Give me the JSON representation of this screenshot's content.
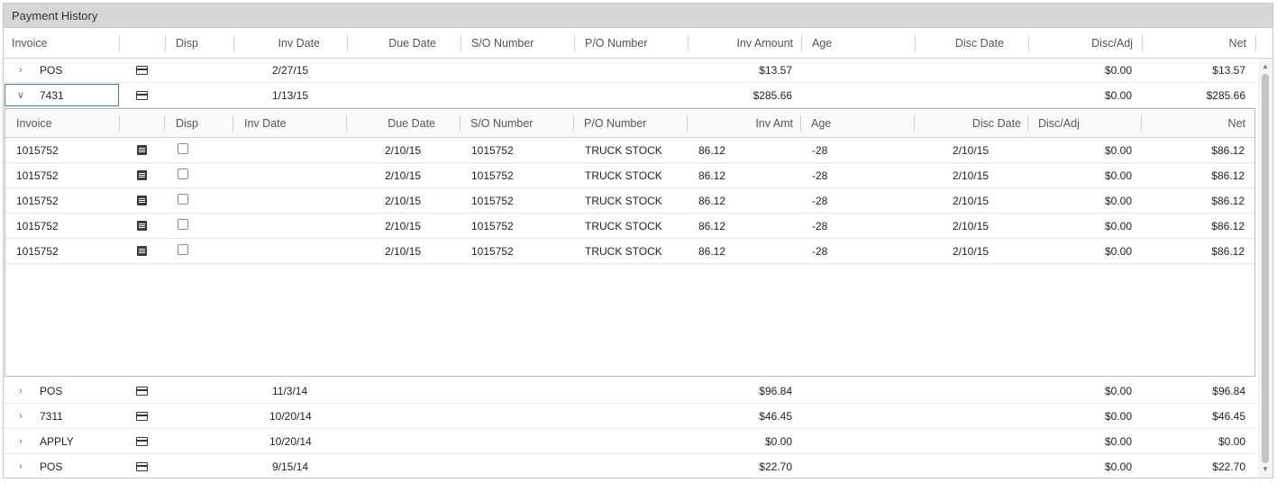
{
  "panel": {
    "title": "Payment History"
  },
  "columns": [
    "Invoice",
    "Disp",
    "Inv Date",
    "Due Date",
    "S/O Number",
    "P/O Number",
    "Inv Amount",
    "Age",
    "Disc Date",
    "Disc/Adj",
    "Net"
  ],
  "rows_top": [
    {
      "invoice": "POS",
      "inv_date": "2/27/15",
      "inv_amount": "$13.57",
      "disc_adj": "$0.00",
      "net": "$13.57",
      "expanded": false,
      "chevron": "chevron-right-icon"
    },
    {
      "invoice": "7431",
      "inv_date": "1/13/15",
      "inv_amount": "$285.66",
      "disc_adj": "$0.00",
      "net": "$285.66",
      "expanded": true,
      "chevron": "chevron-down-icon"
    }
  ],
  "detail": {
    "columns": [
      "Invoice",
      "Disp",
      "Inv Date",
      "Due Date",
      "S/O Number",
      "P/O Number",
      "Inv Amt",
      "Age",
      "Disc Date",
      "Disc/Adj",
      "Net"
    ],
    "rows": [
      {
        "invoice": "1015752",
        "due_date": "2/10/15",
        "so_number": "1015752",
        "po_number": "TRUCK STOCK",
        "inv_amt": "86.12",
        "age": "-28",
        "disc_date": "2/10/15",
        "disc_adj": "$0.00",
        "net": "$86.12"
      },
      {
        "invoice": "1015752",
        "due_date": "2/10/15",
        "so_number": "1015752",
        "po_number": "TRUCK STOCK",
        "inv_amt": "86.12",
        "age": "-28",
        "disc_date": "2/10/15",
        "disc_adj": "$0.00",
        "net": "$86.12"
      },
      {
        "invoice": "1015752",
        "due_date": "2/10/15",
        "so_number": "1015752",
        "po_number": "TRUCK STOCK",
        "inv_amt": "86.12",
        "age": "-28",
        "disc_date": "2/10/15",
        "disc_adj": "$0.00",
        "net": "$86.12"
      },
      {
        "invoice": "1015752",
        "due_date": "2/10/15",
        "so_number": "1015752",
        "po_number": "TRUCK STOCK",
        "inv_amt": "86.12",
        "age": "-28",
        "disc_date": "2/10/15",
        "disc_adj": "$0.00",
        "net": "$86.12"
      },
      {
        "invoice": "1015752",
        "due_date": "2/10/15",
        "so_number": "1015752",
        "po_number": "TRUCK STOCK",
        "inv_amt": "86.12",
        "age": "-28",
        "disc_date": "2/10/15",
        "disc_adj": "$0.00",
        "net": "$86.12"
      }
    ]
  },
  "rows_bottom": [
    {
      "invoice": "POS",
      "inv_date": "11/3/14",
      "inv_amount": "$96.84",
      "disc_adj": "$0.00",
      "net": "$96.84"
    },
    {
      "invoice": "7311",
      "inv_date": "10/20/14",
      "inv_amount": "$46.45",
      "disc_adj": "$0.00",
      "net": "$46.45"
    },
    {
      "invoice": "APPLY",
      "inv_date": "10/20/14",
      "inv_amount": "$0.00",
      "disc_adj": "$0.00",
      "net": "$0.00"
    },
    {
      "invoice": "POS",
      "inv_date": "9/15/14",
      "inv_amount": "$22.70",
      "disc_adj": "$0.00",
      "net": "$22.70"
    }
  ],
  "colors": {
    "selection": "#3b7bd3",
    "titlebar": "#d6d6d6"
  }
}
